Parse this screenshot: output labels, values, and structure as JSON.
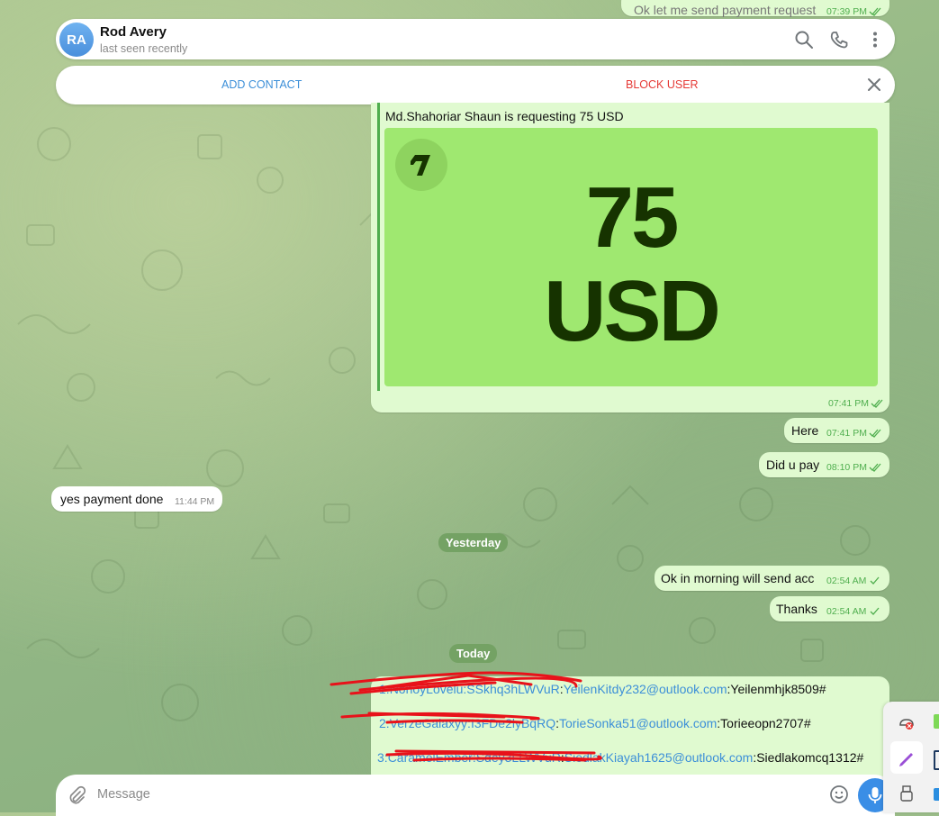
{
  "header": {
    "avatar_initials": "RA",
    "contact_name": "Rod Avery",
    "status": "last seen recently"
  },
  "action_bar": {
    "add_contact": "ADD CONTACT",
    "block_user": "BLOCK USER"
  },
  "messages": {
    "top_partial": {
      "text": "Ok let me send payment request",
      "time": "07:39 PM"
    },
    "payment_request": {
      "caption": "Md.Shahoriar Shaun is requesting 75 USD",
      "amount": "75",
      "currency": "USD",
      "time": "07:41 PM"
    },
    "here": {
      "text": "Here",
      "time": "07:41 PM"
    },
    "did_u_pay": {
      "text": "Did u pay",
      "time": "08:10 PM"
    },
    "payment_done": {
      "text": "yes payment done",
      "time": "11:44 PM"
    },
    "date_yesterday": "Yesterday",
    "ok_morning": {
      "text": "Ok in morning will send acc",
      "time": "02:54 AM"
    },
    "thanks": {
      "text": "Thanks",
      "time": "02:54 AM"
    },
    "date_today": "Today",
    "accounts": [
      {
        "prefix": "1:",
        "redacted": "NonoyLovelu:SSkhq3hLWVuR",
        "email": "YeilenKitdy232@outlook.com",
        "password": ":Yeilenmhjk8509#"
      },
      {
        "prefix": "2:",
        "redacted": "VerzeGalaxyy:I3FDe2lyBqRQ",
        "email": "TorieSonka51@outlook.com",
        "password": ":Torieeopn2707#"
      },
      {
        "prefix": "3:",
        "redacted": "CaramelEmber:Sdey3LLWVuR",
        "email": "SiedlakKiayah1625@outlook.com",
        "password": ":Siedlakomcq1312#"
      }
    ]
  },
  "composer": {
    "placeholder": "Message"
  },
  "colors": {
    "outgoing_bubble": "#e0fad0",
    "wise_green": "#9fe870",
    "wise_dark": "#163300",
    "accent_blue": "#3c8fd8",
    "danger_red": "#e53935"
  }
}
